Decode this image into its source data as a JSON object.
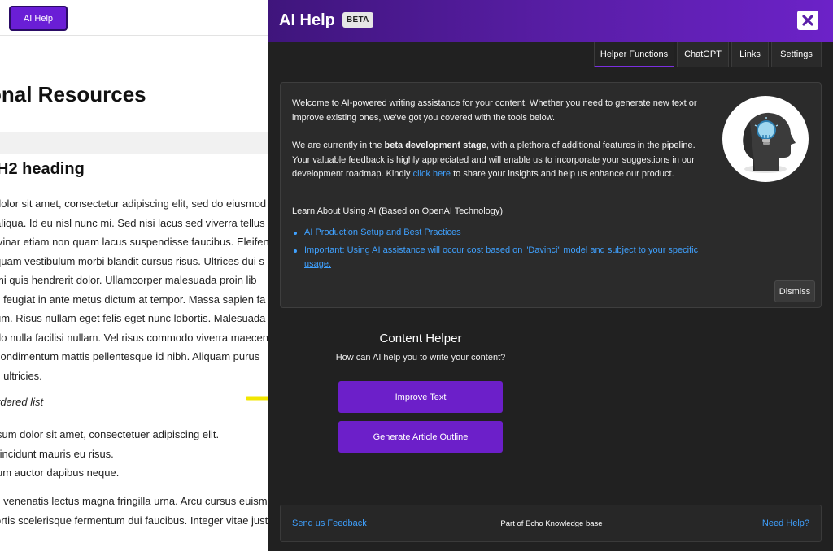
{
  "background_page": {
    "ai_help_button": "AI Help",
    "heading": "onal Resources",
    "h2": "H2 heading",
    "paragraph_lines": [
      "dolor sit amet, consectetur adipiscing elit, sed do eiusmod",
      "aliqua. Id eu nisl nunc mi. Sed nisi lacus sed viverra tellus",
      "lvinar etiam non quam lacus suspendisse faucibus. Eleifen",
      "quam vestibulum morbi blandit cursus risus. Ultrices dui s",
      " mi quis hendrerit dolor. Ullamcorper malesuada proin lib",
      "s feugiat in ante metus dictum at tempor. Massa sapien fa",
      "um. Risus nullam eget felis eget nunc lobortis. Malesuada",
      "do nulla facilisi nullam. Vel risus commodo viverra maecen",
      " condimentum mattis pellentesque id nibh. Aliquam purus",
      "s ultricies."
    ],
    "ordered_list_label": "rdered list",
    "list_items": [
      "sum dolor sit amet, consectetuer adipiscing elit.",
      "tincidunt mauris eu risus.",
      "um auctor dapibus neque."
    ],
    "paragraph2_lines": [
      "s venenatis lectus magna fringilla urna. Arcu cursus euismo",
      "ortis scelerisque fermentum dui faucibus. Integer vitae just"
    ]
  },
  "panel": {
    "title": "AI Help",
    "badge": "BETA",
    "tabs": [
      {
        "label": "Helper Functions",
        "active": true
      },
      {
        "label": "ChatGPT",
        "active": false
      },
      {
        "label": "Links",
        "active": false
      },
      {
        "label": "Settings",
        "active": false
      }
    ],
    "info": {
      "intro": "Welcome to AI-powered writing assistance for your content. Whether you need to generate new text or improve existing ones, we've got you covered with the tools below.",
      "dev_prefix": "We are currently in the ",
      "dev_bold": "beta development stage",
      "dev_middle": ", with a plethora of additional features in the pipeline. Your valuable feedback is highly appreciated and will enable us to incorporate your suggestions in our development roadmap. Kindly ",
      "dev_link": "click here",
      "dev_suffix": " to share your insights and help us enhance our product.",
      "learn_heading": "Learn About Using AI (Based on OpenAI Technology)",
      "links": [
        "AI Production Setup and Best Practices",
        "Important: Using AI assistance will occur cost based on \"Davinci\" model and subject to your specific usage."
      ],
      "dismiss": "Dismiss"
    },
    "content_helper": {
      "title": "Content Helper",
      "subtitle": "How can AI help you to write your content?",
      "buttons": [
        "Improve Text",
        "Generate Article Outline"
      ]
    },
    "footer": {
      "feedback": "Send us Feedback",
      "middle": "Part of Echo Knowledge base",
      "help": "Need Help?"
    }
  },
  "colors": {
    "accent": "#6c1fc9",
    "link": "#3fa1ff",
    "panel_bg": "#212121",
    "arrow": "#f2e600"
  },
  "icons": [
    "close-icon",
    "ai-head-lightbulb-icon",
    "arrow-pointer-icon"
  ]
}
